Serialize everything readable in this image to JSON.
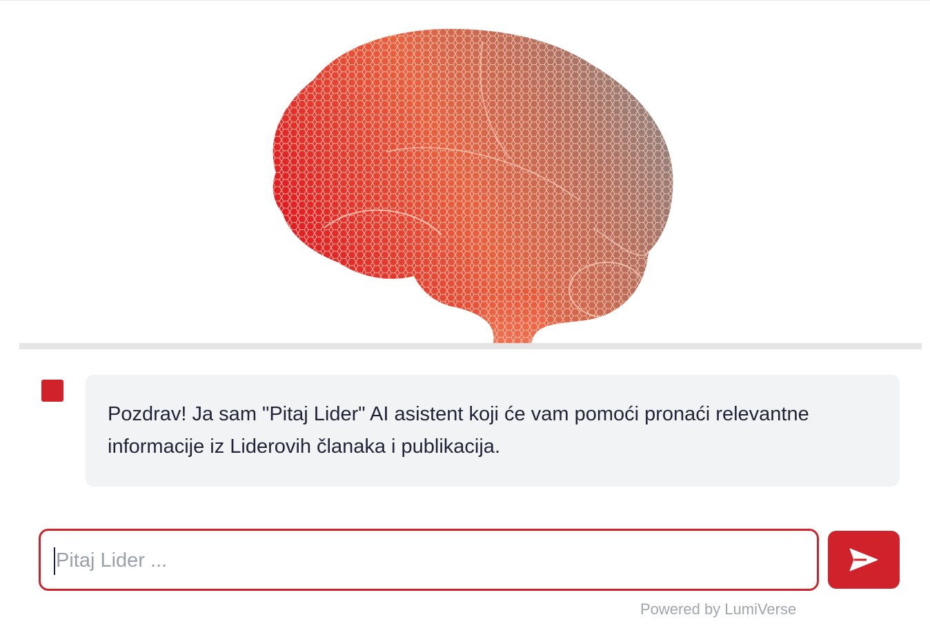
{
  "hero": {
    "image_icon": "brain-mesh-illustration",
    "gradient_colors": [
      "#e0141f",
      "#ef6a4f",
      "#8a8888"
    ]
  },
  "chat": {
    "assistant_avatar_color": "#d0222b",
    "messages": [
      {
        "role": "assistant",
        "text": "Pozdrav! Ja sam \"Pitaj Lider\" AI asistent koji će vam pomoći pronaći relevantne informacije iz Liderovih članaka i publikacija."
      }
    ]
  },
  "input": {
    "placeholder": "Pitaj Lider ...",
    "value": ""
  },
  "send_button": {
    "icon": "send-icon",
    "color": "#d0222b"
  },
  "footer": {
    "powered_by": "Powered by LumiVerse"
  }
}
